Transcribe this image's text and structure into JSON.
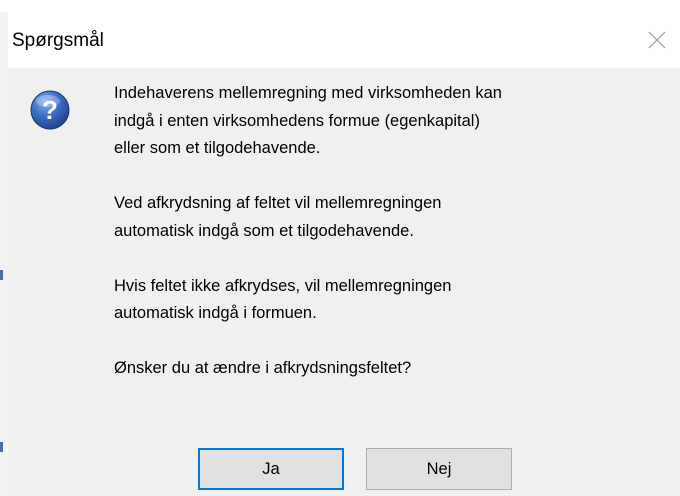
{
  "dialog": {
    "title": "Spørgsmål",
    "icon": "question-icon",
    "close_icon": "close-icon",
    "message": [
      "Indehaverens mellemregning med virksomheden kan\nindgå i enten virksomhedens formue (egenkapital)\neller som et tilgodehavende.",
      "Ved afkrydsning af feltet vil mellemregningen\nautomatisk indgå som et tilgodehavende.",
      "Hvis feltet ikke afkrydses, vil mellemregningen\nautomatisk indgå i formuen.",
      "Ønsker du at ændre i afkrydsningsfeltet?"
    ],
    "buttons": {
      "yes_label": "Ja",
      "no_label": "Nej"
    },
    "colors": {
      "accent": "#0078d7",
      "icon_blue": "#2a5aa8"
    }
  }
}
